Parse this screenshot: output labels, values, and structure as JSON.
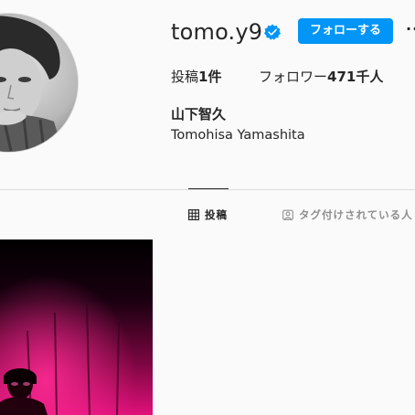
{
  "profile": {
    "username": "tomo.y9",
    "follow_label": "フォローする",
    "more_label": "···",
    "stats": {
      "posts_label": "投稿",
      "posts_count": "1件",
      "followers_label": "フォロワー",
      "followers_count": "471千人"
    },
    "full_name": "山下智久",
    "romanized_name": "Tomohisa Yamashita"
  },
  "tabs": [
    {
      "label": "投稿",
      "icon": "grid-icon",
      "active": true
    },
    {
      "label": "タグ付けされている人",
      "icon": "tagged-icon",
      "active": false
    }
  ],
  "colors": {
    "follow_button": "#0095f6",
    "verified_badge": "#0095f6",
    "post_thumbnail_tint": "#e0107a"
  }
}
